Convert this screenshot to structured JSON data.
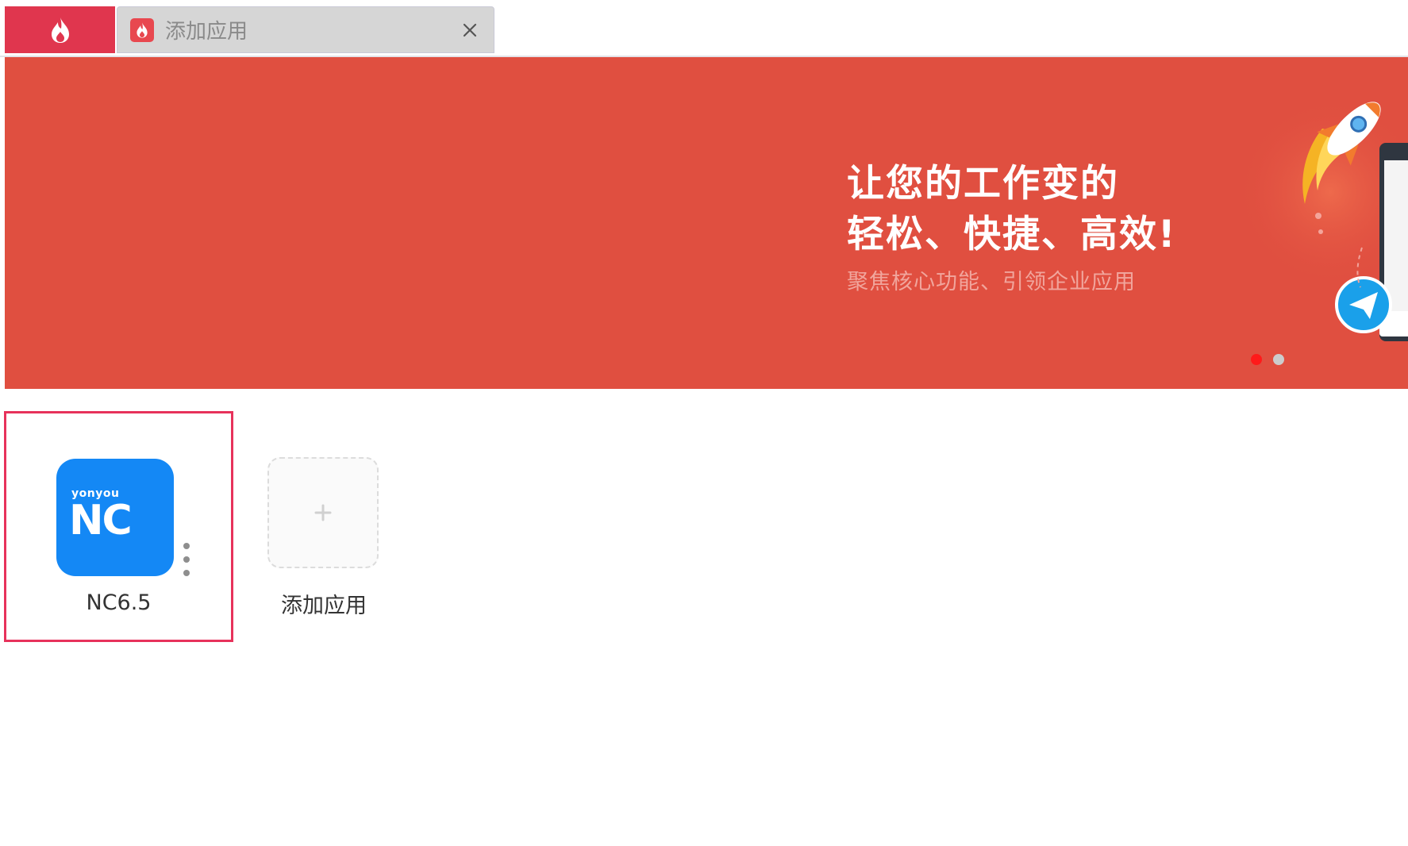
{
  "tabs": {
    "home_icon": "flame-logo-icon",
    "active_tab": {
      "title": "添加应用",
      "icon": "flame-logo-icon",
      "close_icon": "close-icon"
    }
  },
  "banner": {
    "headline": "让您的工作变的\n轻松、快捷、高效!",
    "subline": "聚焦核心功能、引领企业应用",
    "background_color": "#e04f40",
    "carousel": {
      "slide_count": 2,
      "active_index": 0,
      "active_color": "#ff1a1a",
      "inactive_color": "#cccccc"
    }
  },
  "apps": [
    {
      "name": "NC6.5",
      "icon_brand_small": "yonyou",
      "icon_brand_big": "NC",
      "icon_color": "#1488f5",
      "menu_icon": "more-vertical-icon",
      "selected": true
    }
  ],
  "add_app": {
    "label": "添加应用",
    "icon": "plus-icon"
  }
}
